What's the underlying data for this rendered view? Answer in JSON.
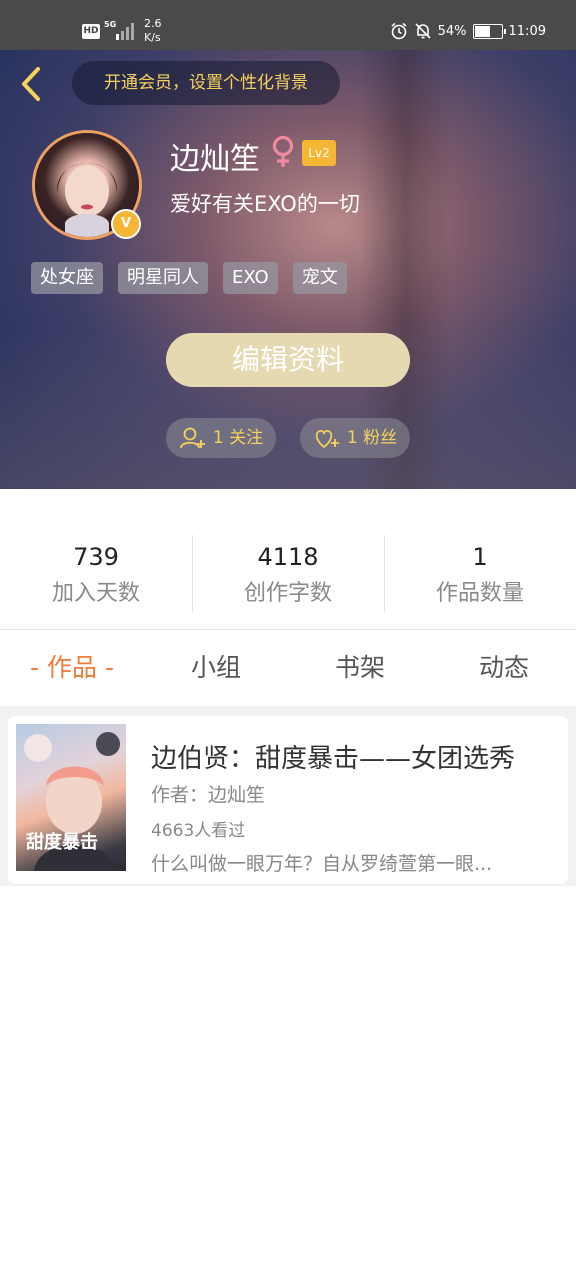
{
  "status_bar": {
    "hd": "HD",
    "network": "5G",
    "speed": "2.6\nK/s",
    "speed_line1": "2.6",
    "speed_line2": "K/s",
    "battery": "54%",
    "time": "11:09"
  },
  "header": {
    "vip_banner": "开通会员，设置个性化背景",
    "username": "边灿笙",
    "level": "Lv2",
    "verified_badge": "V",
    "bio": "爱好有关EXO的一切",
    "tags": [
      "处女座",
      "明星同人",
      "EXO",
      "宠文"
    ],
    "edit_button": "编辑资料",
    "following": "1 关注",
    "followers": "1 粉丝"
  },
  "stats": [
    {
      "value": "739",
      "label": "加入天数"
    },
    {
      "value": "4118",
      "label": "创作字数"
    },
    {
      "value": "1",
      "label": "作品数量"
    }
  ],
  "tabs": [
    "- 作品 -",
    "小组",
    "书架",
    "动态"
  ],
  "works": [
    {
      "title": "边伯贤：甜度暴击——女团选秀",
      "author": "作者：边灿笙",
      "views": "4663人看过",
      "description": "什么叫做一眼万年？自从罗绮萱第一眼...",
      "cover_text": "甜度暴击"
    }
  ],
  "colors": {
    "accent": "#f07a38",
    "gold": "#f5d25c",
    "edit_button_bg": "#e5d9b1",
    "female_icon": "#f08aa0",
    "level_badge": "#f5b733"
  },
  "icons": {
    "back": "chevron-left-icon",
    "female": "female-icon",
    "follow": "add-user-icon",
    "fans": "heart-plus-icon",
    "alarm": "alarm-icon",
    "mute": "bell-off-icon"
  }
}
